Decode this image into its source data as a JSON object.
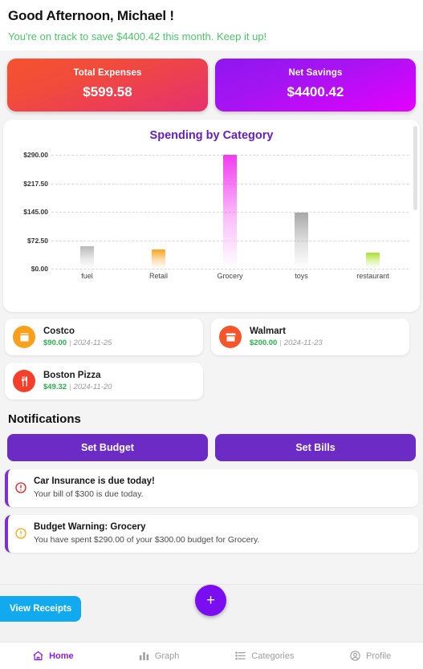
{
  "header": {
    "greeting": "Good Afternoon, Michael !",
    "subtitle": "You're on track to save $4400.42 this month. Keep it up!",
    "greeting_color": "#111111",
    "subtitle_color": "#4ec36a"
  },
  "summary": {
    "expenses": {
      "label": "Total Expenses",
      "value": "$599.58",
      "gradient_from": "#f6522e",
      "gradient_to": "#e63070"
    },
    "savings": {
      "label": "Net Savings",
      "value": "$4400.42",
      "gradient_from": "#8e17f0",
      "gradient_to": "#e400ff"
    }
  },
  "chart_data": {
    "type": "bar",
    "title": "Spending by Category",
    "xlabel": "",
    "ylabel": "",
    "categories": [
      "fuel",
      "Retail",
      "Grocery",
      "toys",
      "restaurant"
    ],
    "values": [
      58.0,
      48.0,
      290.0,
      143.0,
      40.0
    ],
    "bar_colors": [
      "#b8b8b8",
      "#fba21f",
      "#f23cf0",
      "#a8a8a8",
      "#a9e22c"
    ],
    "ylim": [
      0,
      290
    ],
    "yticks": [
      0,
      72.5,
      145,
      217.5,
      290
    ],
    "ytick_labels": [
      "$0.00",
      "$72.50",
      "$145.00",
      "$217.50",
      "$290.00"
    ],
    "grid": true,
    "legend": "none",
    "title_color": "#6320bd"
  },
  "transactions": [
    {
      "name": "Costco",
      "amount": "$90.00",
      "date": "2024-11-25",
      "icon": "store-icon",
      "icon_bg": "#f6a01c"
    },
    {
      "name": "Walmart",
      "amount": "$200.00",
      "date": "2024-11-23",
      "icon": "storefront-icon",
      "icon_bg": "#f4552a"
    },
    {
      "name": "Boston Pizza",
      "amount": "$49.32",
      "date": "2024-11-20",
      "icon": "cutlery-icon",
      "icon_bg": "#f4402a"
    }
  ],
  "notifications": {
    "section_title": "Notifications",
    "buttons": [
      {
        "label": "Set Budget"
      },
      {
        "label": "Set Bills"
      }
    ],
    "button_color": "#6b2bc4",
    "alerts": [
      {
        "title": "Car Insurance  is due today!",
        "text": "Your bill of $300 is due today.",
        "icon": "alert-circle-icon",
        "icon_color": "#e02020",
        "accent": "#7b2fd4"
      },
      {
        "title": "Budget Warning: Grocery",
        "text": "You have spent $290.00 of your $300.00 budget for Grocery.",
        "icon": "alert-circle-icon",
        "icon_color": "#f0ab1e",
        "accent": "#7b2fd4"
      }
    ]
  },
  "footer": {
    "view_receipts_label": "View Receipts",
    "view_receipts_color": "#12aaef",
    "fab_label": "+",
    "fab_color": "#7a0ef0"
  },
  "nav": {
    "items": [
      {
        "label": "Home",
        "icon": "home-icon",
        "active": true
      },
      {
        "label": "Graph",
        "icon": "bar-chart-icon",
        "active": false
      },
      {
        "label": "Categories",
        "icon": "list-icon",
        "active": false
      },
      {
        "label": "Profile",
        "icon": "user-circle-icon",
        "active": false
      }
    ],
    "active_color": "#8a1ae8",
    "inactive_color": "#9e9e9e"
  }
}
